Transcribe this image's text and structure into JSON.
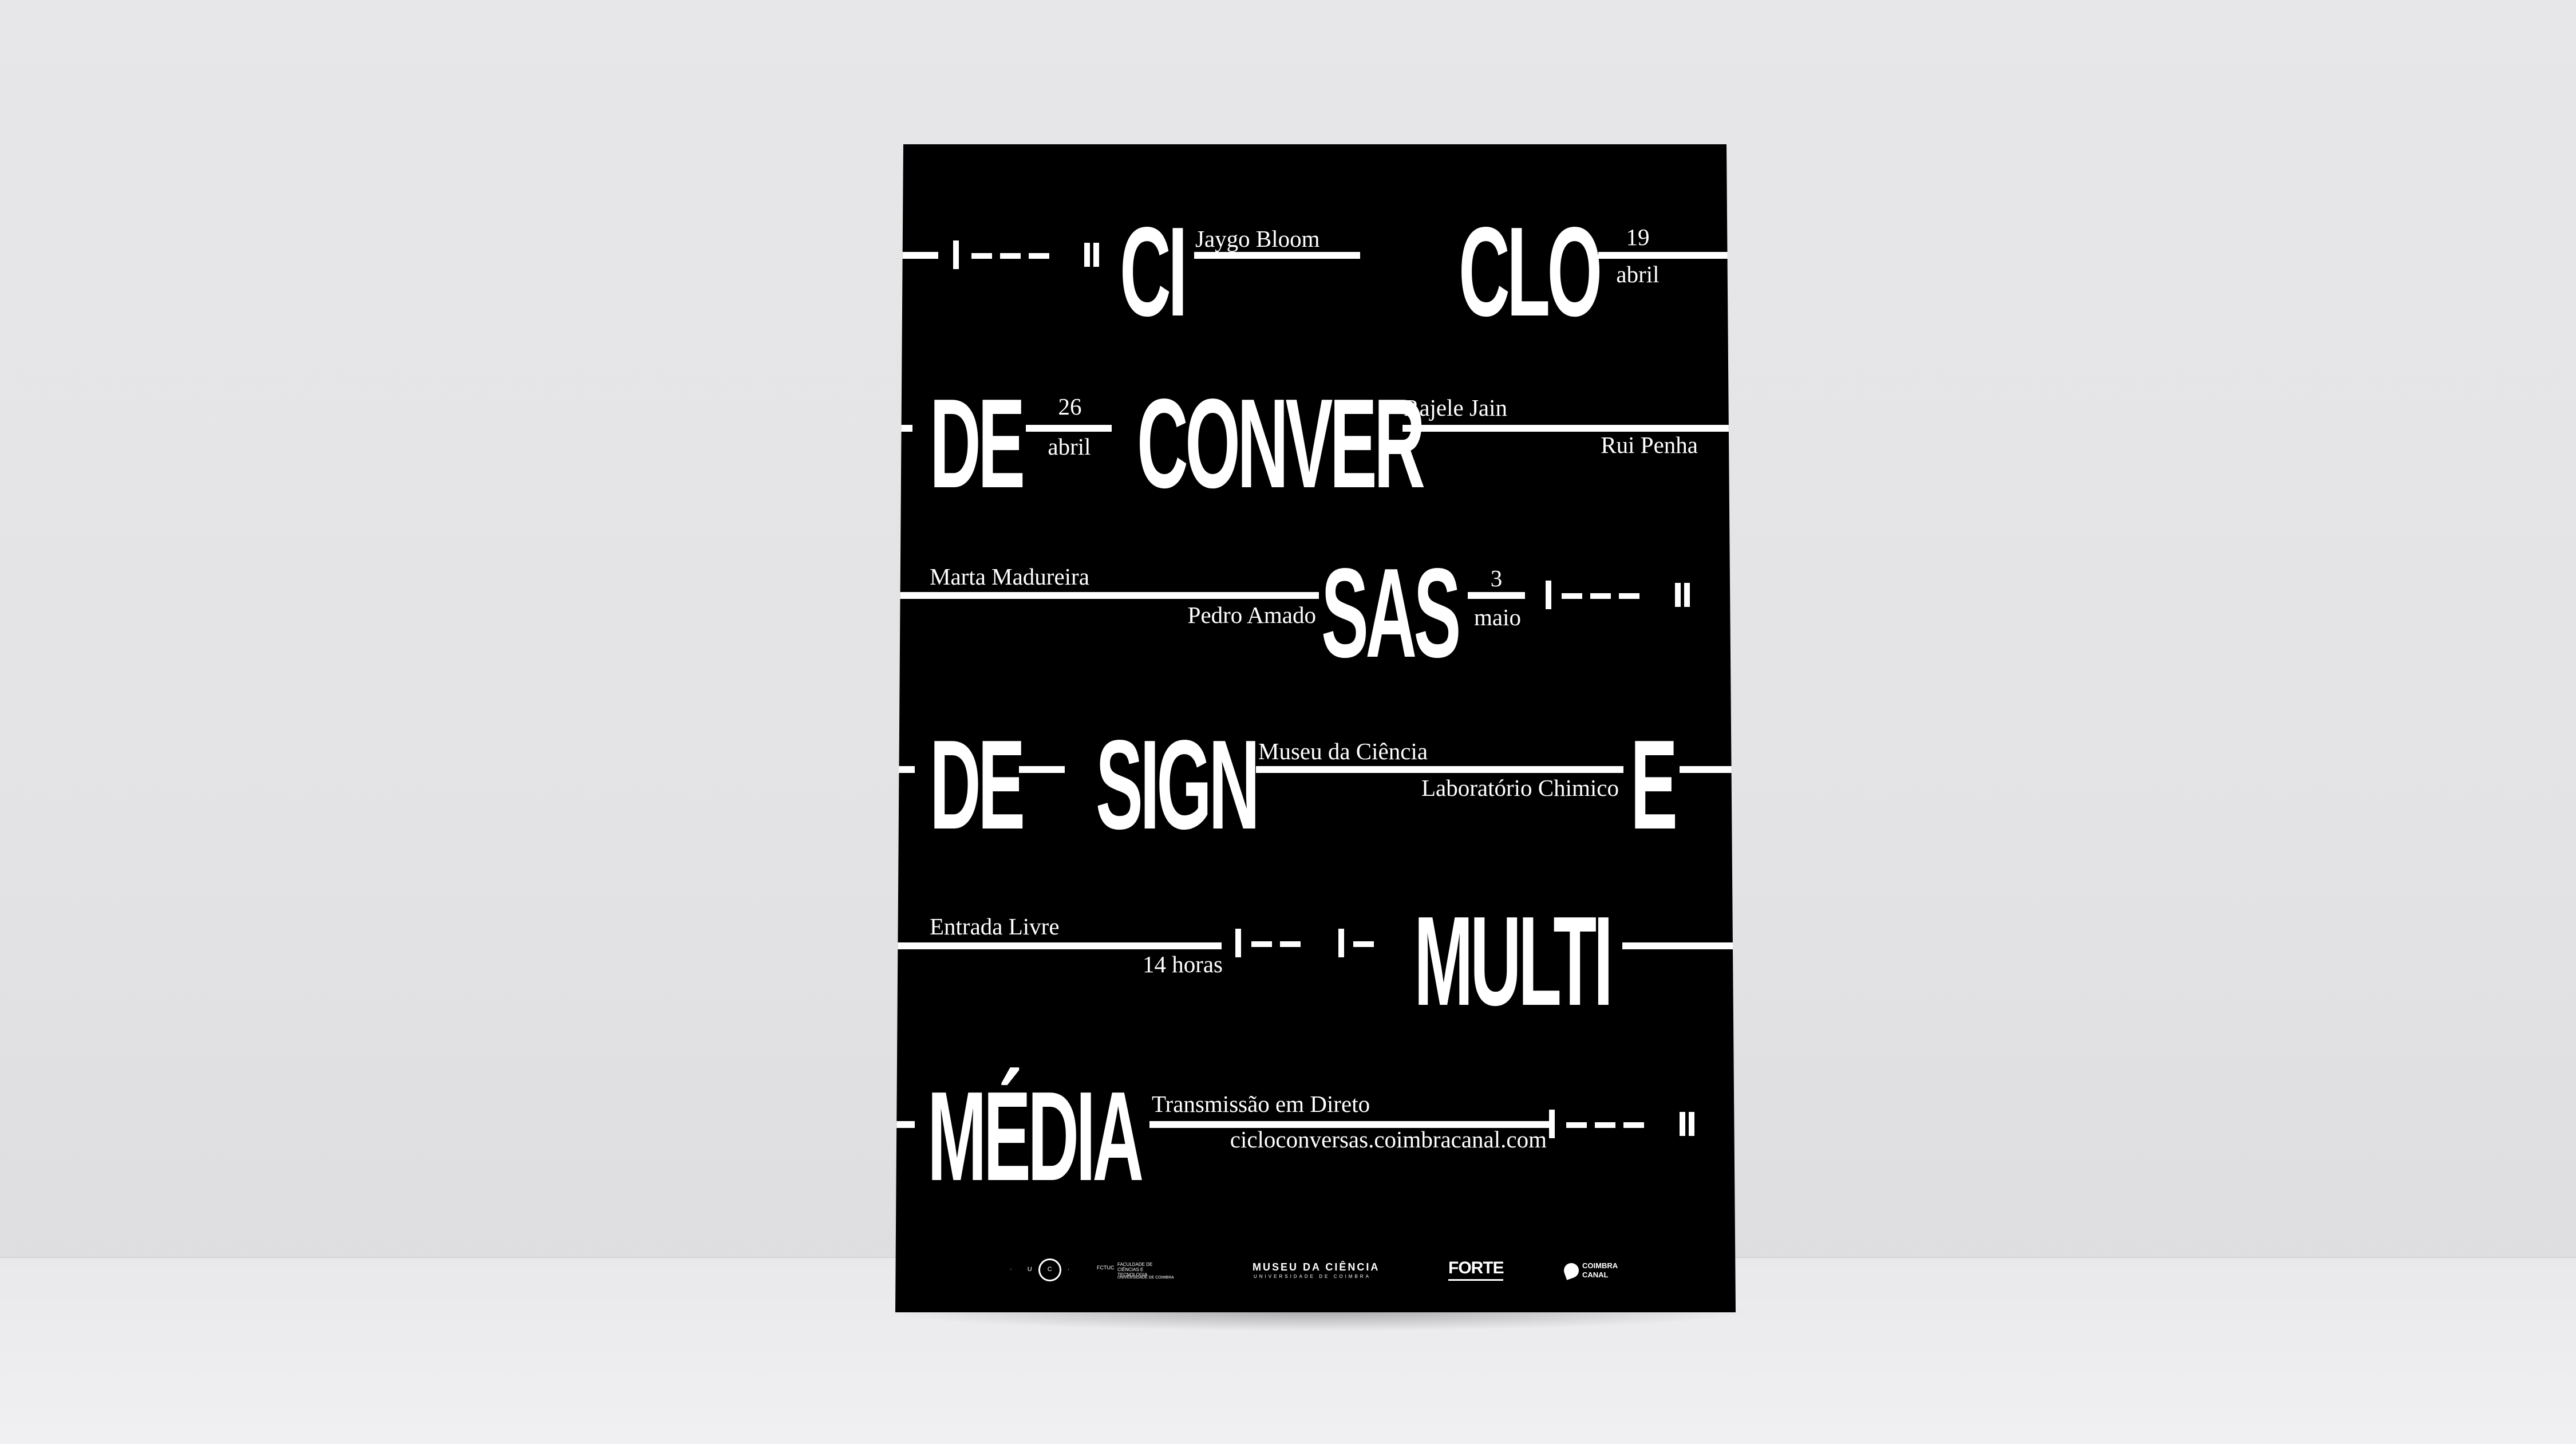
{
  "poster": {
    "rows": {
      "r1": {
        "w1": "CI",
        "w2": "CLO",
        "speaker": "Jaygo Bloom",
        "day": "19",
        "month": "abril"
      },
      "r2": {
        "w1": "DE",
        "w2": "CONVER",
        "day": "26",
        "month": "abril",
        "speaker_a": "Rajele Jain",
        "speaker_b": "Rui Penha"
      },
      "r3": {
        "speaker_a": "Marta Madureira",
        "speaker_b": "Pedro Amado",
        "w1": "SAS",
        "day": "3",
        "month": "maio"
      },
      "r4": {
        "w1": "DE",
        "w2": "SIGN",
        "venue_a": "Museu da Ciência",
        "venue_b": "Laboratório Chimico",
        "w3": "E"
      },
      "r5": {
        "entry": "Entrada Livre",
        "time": "14 horas",
        "w1": "MULTI"
      },
      "r6": {
        "w1": "MÉDIA",
        "stream_a": "Transmissão em Direto",
        "stream_b": "cicloconversas.coimbracanal.com"
      }
    },
    "logos": {
      "uc_letters": "· U C ·",
      "fctuc_abbr": "FCTUC",
      "fctuc_name": "FACULDADE DE CIÊNCIAS E TECNOLOGIA",
      "fctuc_univ": "UNIVERSIDADE DE COIMBRA",
      "museu_name": "MUSEU DA CIÊNCIA",
      "museu_univ": "UNIVERSIDADE DE COIMBRA",
      "forte": "FORTE",
      "coimbra": "COIMBRA",
      "canal": "CANAL"
    }
  },
  "colors": {
    "wall": "#e5e5e7",
    "poster": "#000000",
    "ink": "#ffffff"
  }
}
